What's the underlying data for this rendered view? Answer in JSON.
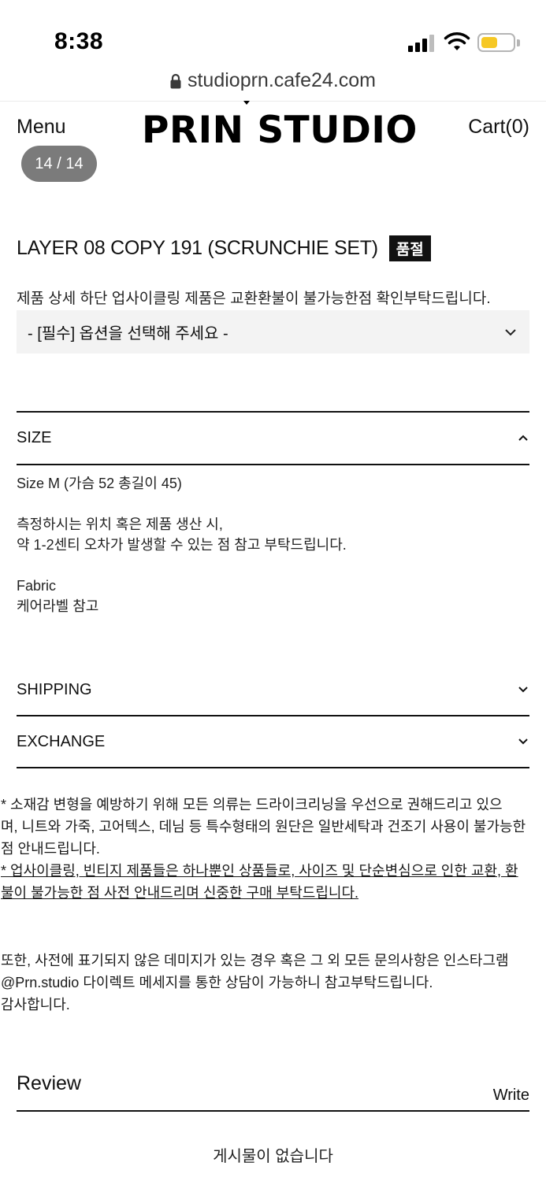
{
  "status_bar": {
    "time": "8:38",
    "battery_color": "#f6c825",
    "icons": [
      "signal-icon",
      "wifi-icon",
      "battery-icon"
    ]
  },
  "browser": {
    "url": "studioprn.cafe24.com",
    "icon": "lock-icon"
  },
  "header": {
    "menu_label": "Menu",
    "logo_text": "PRIN STUDIO",
    "cart_label": "Cart(0)",
    "image_counter": "14 / 14"
  },
  "product": {
    "title": "LAYER 08 COPY 191 (SCRUNCHIE SET)",
    "soldout_badge": "품절",
    "notice": "제품 상세 하단 업사이클링 제품은 교환환불이 불가능한점 확인부탁드립니다.",
    "option_placeholder": "- [필수] 옵션을 선택해 주세요 -"
  },
  "accordions": {
    "size": {
      "title": "SIZE",
      "expanded": true,
      "size_line": "Size  M (가슴 52 총길이 45)",
      "measure_line1": "측정하시는 위치 혹은 제품 생산 시,",
      "measure_line2": "약 1-2센티 오차가 발생할 수 있는 점 참고 부탁드립니다.",
      "fabric_label": "Fabric",
      "fabric_value": "케어라벨 참고"
    },
    "shipping": {
      "title": "SHIPPING",
      "expanded": false
    },
    "exchange": {
      "title": "EXCHANGE",
      "expanded": false
    }
  },
  "care_note": {
    "line1": "* 소재감 변형을 예방하기 위해 모든 의류는 드라이크리닝을 우선으로 권해드리고 있으",
    "line2": "며, 니트와 가죽, 고어텍스, 데님 등 특수형태의 원단은 일반세탁과 건조기 사용이 불가능한",
    "line3": "점 안내드립니다.",
    "line4": "* 업사이클링, 빈티지 제품들은 하나뿐인 상품들로, 사이즈 및 단순변심으로 인한 교환, 환",
    "line5": "불이 불가능한 점 사전 안내드리며 신중한 구매 부탁드립니다."
  },
  "contact_note": {
    "line1": "또한, 사전에 표기되지 않은 데미지가 있는 경우 혹은 그 외 모든 문의사항은 인스타그램",
    "line2": "@Prn.studio 다이렉트 메세지를 통한 상담이 가능하니 참고부탁드립니다.",
    "line3": "감사합니다."
  },
  "review": {
    "title": "Review",
    "write_label": "Write",
    "empty_message": "게시물이 없습니다"
  }
}
